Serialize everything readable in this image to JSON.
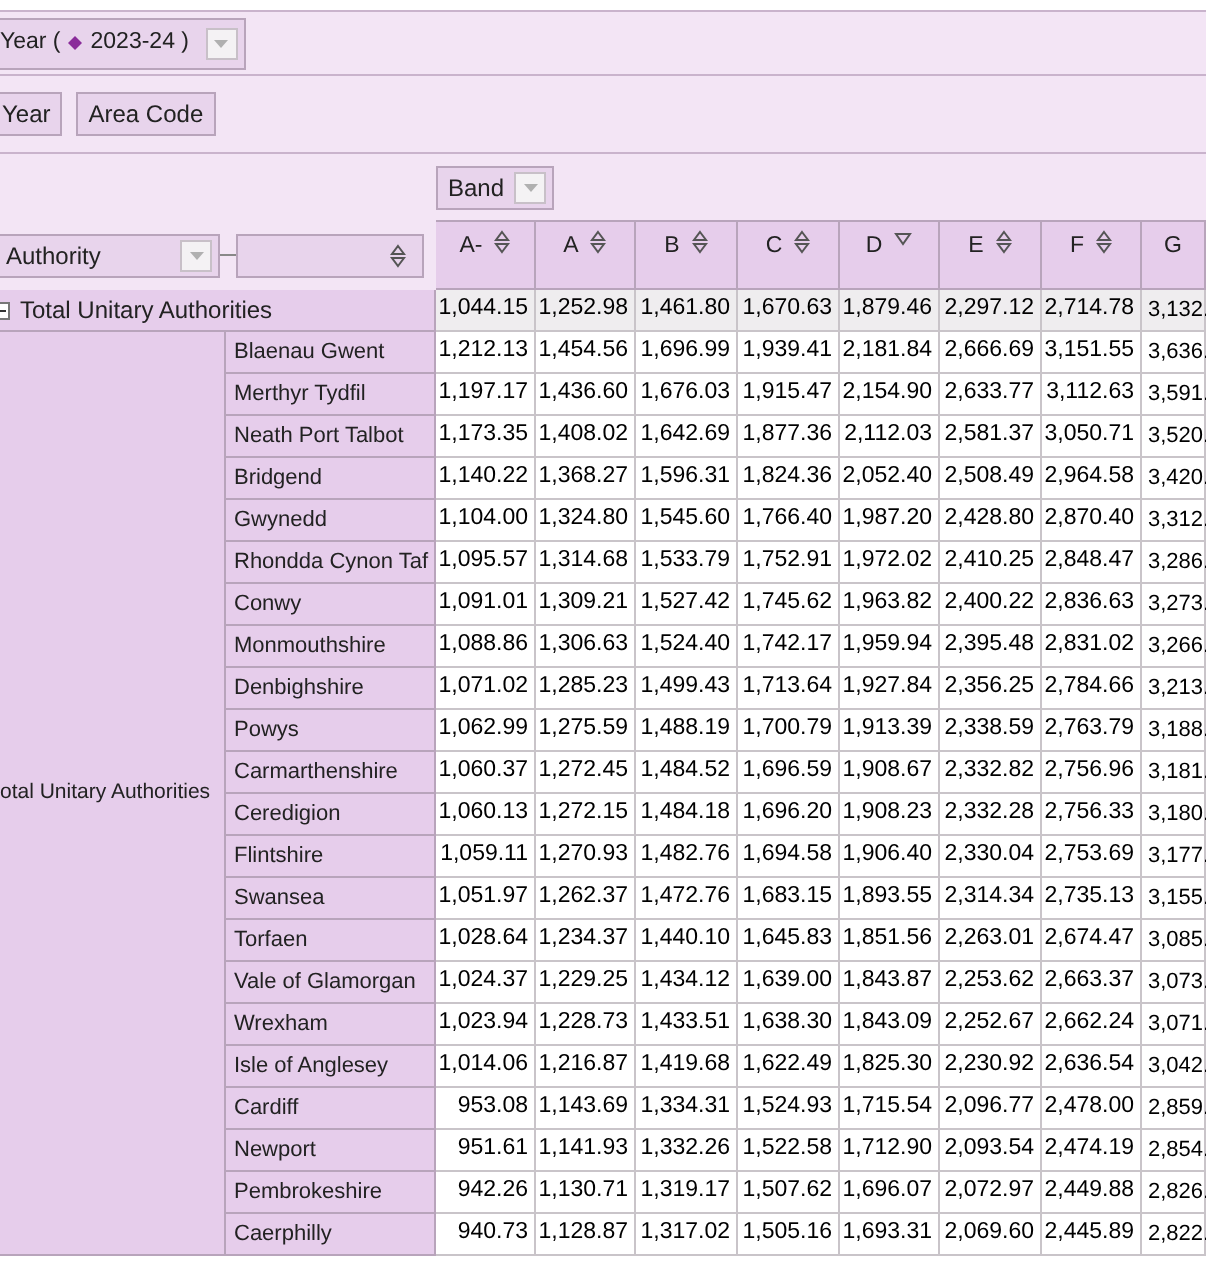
{
  "page_filter": {
    "label": "Year (",
    "value": "2023-24 )"
  },
  "field_chips": [
    "Year",
    "Area Code"
  ],
  "column_field": {
    "label": "Band"
  },
  "row_field": {
    "label": "Authority"
  },
  "columns": [
    {
      "label": "A-",
      "sorted": false
    },
    {
      "label": "A",
      "sorted": false
    },
    {
      "label": "B",
      "sorted": false
    },
    {
      "label": "C",
      "sorted": false
    },
    {
      "label": "D",
      "sorted": true
    },
    {
      "label": "E",
      "sorted": false
    },
    {
      "label": "F",
      "sorted": false
    },
    {
      "label": "G"
    }
  ],
  "total_row": {
    "label": "Total Unitary Authorities",
    "expanded": true,
    "values": [
      "1,044.15",
      "1,252.98",
      "1,461.80",
      "1,670.63",
      "1,879.46",
      "2,297.12",
      "2,714.78",
      "3,132."
    ]
  },
  "group": {
    "label": "otal Unitary Authorities",
    "rows": [
      {
        "label": "Blaenau Gwent",
        "values": [
          "1,212.13",
          "1,454.56",
          "1,696.99",
          "1,939.41",
          "2,181.84",
          "2,666.69",
          "3,151.55",
          "3,636."
        ]
      },
      {
        "label": "Merthyr Tydfil",
        "values": [
          "1,197.17",
          "1,436.60",
          "1,676.03",
          "1,915.47",
          "2,154.90",
          "2,633.77",
          "3,112.63",
          "3,591."
        ]
      },
      {
        "label": "Neath Port Talbot",
        "values": [
          "1,173.35",
          "1,408.02",
          "1,642.69",
          "1,877.36",
          "2,112.03",
          "2,581.37",
          "3,050.71",
          "3,520."
        ]
      },
      {
        "label": "Bridgend",
        "values": [
          "1,140.22",
          "1,368.27",
          "1,596.31",
          "1,824.36",
          "2,052.40",
          "2,508.49",
          "2,964.58",
          "3,420."
        ]
      },
      {
        "label": "Gwynedd",
        "values": [
          "1,104.00",
          "1,324.80",
          "1,545.60",
          "1,766.40",
          "1,987.20",
          "2,428.80",
          "2,870.40",
          "3,312."
        ]
      },
      {
        "label": "Rhondda Cynon Taf",
        "values": [
          "1,095.57",
          "1,314.68",
          "1,533.79",
          "1,752.91",
          "1,972.02",
          "2,410.25",
          "2,848.47",
          "3,286."
        ]
      },
      {
        "label": "Conwy",
        "values": [
          "1,091.01",
          "1,309.21",
          "1,527.42",
          "1,745.62",
          "1,963.82",
          "2,400.22",
          "2,836.63",
          "3,273."
        ]
      },
      {
        "label": "Monmouthshire",
        "values": [
          "1,088.86",
          "1,306.63",
          "1,524.40",
          "1,742.17",
          "1,959.94",
          "2,395.48",
          "2,831.02",
          "3,266."
        ]
      },
      {
        "label": "Denbighshire",
        "values": [
          "1,071.02",
          "1,285.23",
          "1,499.43",
          "1,713.64",
          "1,927.84",
          "2,356.25",
          "2,784.66",
          "3,213."
        ]
      },
      {
        "label": "Powys",
        "values": [
          "1,062.99",
          "1,275.59",
          "1,488.19",
          "1,700.79",
          "1,913.39",
          "2,338.59",
          "2,763.79",
          "3,188."
        ]
      },
      {
        "label": "Carmarthenshire",
        "values": [
          "1,060.37",
          "1,272.45",
          "1,484.52",
          "1,696.59",
          "1,908.67",
          "2,332.82",
          "2,756.96",
          "3,181."
        ]
      },
      {
        "label": "Ceredigion",
        "values": [
          "1,060.13",
          "1,272.15",
          "1,484.18",
          "1,696.20",
          "1,908.23",
          "2,332.28",
          "2,756.33",
          "3,180."
        ]
      },
      {
        "label": "Flintshire",
        "values": [
          "1,059.11",
          "1,270.93",
          "1,482.76",
          "1,694.58",
          "1,906.40",
          "2,330.04",
          "2,753.69",
          "3,177."
        ]
      },
      {
        "label": "Swansea",
        "values": [
          "1,051.97",
          "1,262.37",
          "1,472.76",
          "1,683.15",
          "1,893.55",
          "2,314.34",
          "2,735.13",
          "3,155."
        ]
      },
      {
        "label": "Torfaen",
        "values": [
          "1,028.64",
          "1,234.37",
          "1,440.10",
          "1,645.83",
          "1,851.56",
          "2,263.01",
          "2,674.47",
          "3,085."
        ]
      },
      {
        "label": "Vale of Glamorgan",
        "values": [
          "1,024.37",
          "1,229.25",
          "1,434.12",
          "1,639.00",
          "1,843.87",
          "2,253.62",
          "2,663.37",
          "3,073."
        ]
      },
      {
        "label": "Wrexham",
        "values": [
          "1,023.94",
          "1,228.73",
          "1,433.51",
          "1,638.30",
          "1,843.09",
          "2,252.67",
          "2,662.24",
          "3,071."
        ]
      },
      {
        "label": "Isle of Anglesey",
        "values": [
          "1,014.06",
          "1,216.87",
          "1,419.68",
          "1,622.49",
          "1,825.30",
          "2,230.92",
          "2,636.54",
          "3,042."
        ]
      },
      {
        "label": "Cardiff",
        "values": [
          "953.08",
          "1,143.69",
          "1,334.31",
          "1,524.93",
          "1,715.54",
          "2,096.77",
          "2,478.00",
          "2,859."
        ]
      },
      {
        "label": "Newport",
        "values": [
          "951.61",
          "1,141.93",
          "1,332.26",
          "1,522.58",
          "1,712.90",
          "2,093.54",
          "2,474.19",
          "2,854."
        ]
      },
      {
        "label": "Pembrokeshire",
        "values": [
          "942.26",
          "1,130.71",
          "1,319.17",
          "1,507.62",
          "1,696.07",
          "2,072.97",
          "2,449.88",
          "2,826."
        ]
      },
      {
        "label": "Caerphilly",
        "values": [
          "940.73",
          "1,128.87",
          "1,317.02",
          "1,505.16",
          "1,693.31",
          "2,069.60",
          "2,445.89",
          "2,822."
        ]
      }
    ]
  }
}
